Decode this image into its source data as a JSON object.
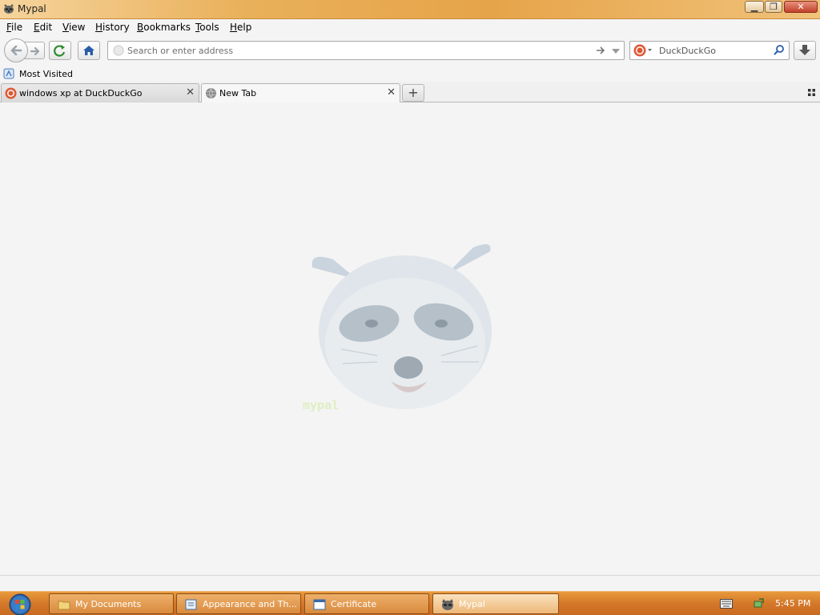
{
  "window": {
    "title": "Mypal",
    "minimize_symbol": "▁",
    "maximize_symbol": "❐",
    "close_symbol": "✕"
  },
  "menu": {
    "items": [
      {
        "label": "File",
        "accel": "F",
        "rest": "ile"
      },
      {
        "label": "Edit",
        "accel": "E",
        "rest": "dit"
      },
      {
        "label": "View",
        "accel": "V",
        "rest": "iew"
      },
      {
        "label": "History",
        "accel": "H",
        "rest": "istory"
      },
      {
        "label": "Bookmarks",
        "accel": "B",
        "rest": "ookmarks"
      },
      {
        "label": "Tools",
        "accel": "T",
        "rest": "ools"
      },
      {
        "label": "Help",
        "accel": "H",
        "rest": "elp"
      }
    ]
  },
  "navbar": {
    "url_placeholder": "Search or enter address",
    "url_value": "",
    "search_engine": "DuckDuckGo"
  },
  "bookmarks": {
    "most_visited": "Most Visited"
  },
  "tabs": [
    {
      "label": "windows xp at DuckDuckGo",
      "active": false
    },
    {
      "label": "New Tab",
      "active": true
    }
  ],
  "newtab_symbol": "+",
  "content": {
    "logo_text": "mypal"
  },
  "taskbar": {
    "buttons": [
      {
        "label": "My Documents"
      },
      {
        "label": "Appearance and Th..."
      },
      {
        "label": "Certificate"
      },
      {
        "label": "Mypal",
        "active": true
      }
    ],
    "clock": "5:45 PM"
  },
  "colors": {
    "title_bar": "#e9b05a",
    "taskbar": "#d4782a",
    "content_bg": "#f4f4f4"
  }
}
